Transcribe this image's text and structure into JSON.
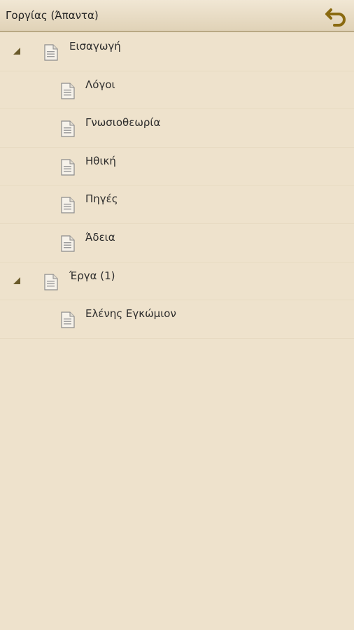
{
  "header": {
    "title": "Γοργίας (Άπαντα)",
    "back_icon": "back-arrow-icon"
  },
  "colors": {
    "background": "#eee2cc",
    "header_border": "#b9a884",
    "accent": "#8a6a10"
  },
  "tree": {
    "items": [
      {
        "label": "Εισαγωγή",
        "level": 0,
        "expanded": true
      },
      {
        "label": "Λόγοι",
        "level": 1
      },
      {
        "label": "Γνωσιοθεωρία",
        "level": 1
      },
      {
        "label": "Ηθική",
        "level": 1
      },
      {
        "label": "Πηγές",
        "level": 1
      },
      {
        "label": "Άδεια",
        "level": 1
      },
      {
        "label": "Έργα (1)",
        "level": 0,
        "expanded": true
      },
      {
        "label": "Ελένης Εγκώμιον",
        "level": 1
      }
    ]
  }
}
